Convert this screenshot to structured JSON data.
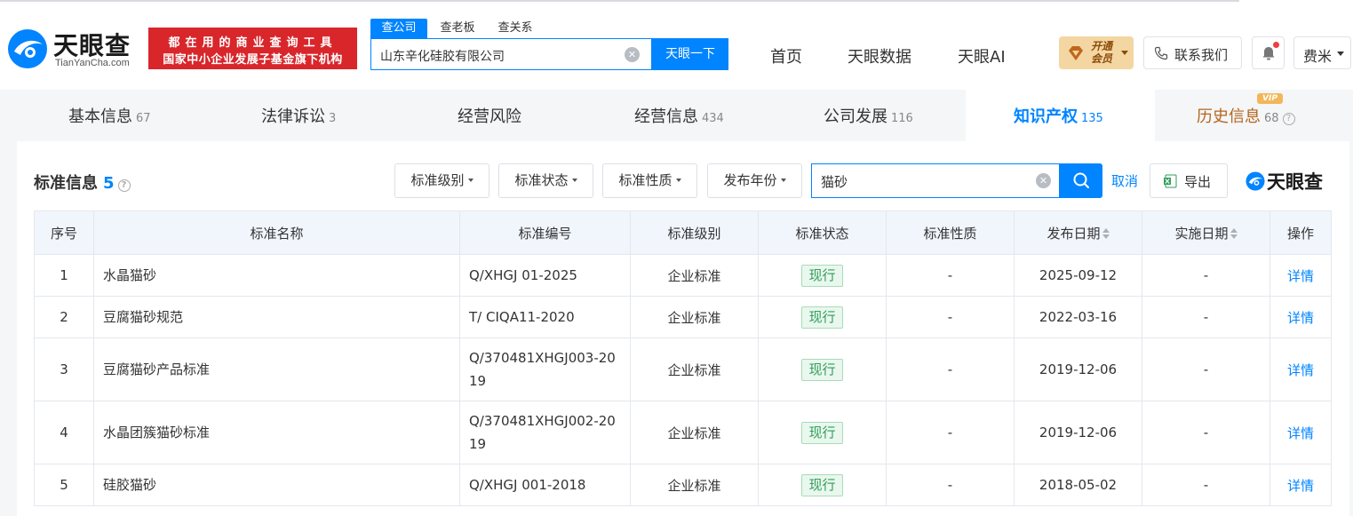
{
  "header": {
    "logo_text": "天眼查",
    "logo_sub": "TianYanCha.com",
    "banner_line1": "都在用的商业查询工具",
    "banner_line2": "国家中小企业发展子基金旗下机构",
    "search_tabs": [
      "查公司",
      "查老板",
      "查关系"
    ],
    "search_value": "山东辛化硅胶有限公司",
    "search_button": "天眼一下",
    "nav": [
      "首页",
      "天眼数据",
      "天眼AI"
    ],
    "vip_label": "开通会员",
    "contact_label": "联系我们",
    "user_name": "费米"
  },
  "tabs": [
    {
      "label": "基本信息",
      "count": "67"
    },
    {
      "label": "法律诉讼",
      "count": "3"
    },
    {
      "label": "经营风险",
      "count": ""
    },
    {
      "label": "经营信息",
      "count": "434"
    },
    {
      "label": "公司发展",
      "count": "116"
    },
    {
      "label": "知识产权",
      "count": "135"
    },
    {
      "label": "历史信息",
      "count": "68"
    }
  ],
  "vip_tag": "VIP",
  "section": {
    "title": "标准信息",
    "count": "5",
    "filters": [
      "标准级别",
      "标准状态",
      "标准性质",
      "发布年份"
    ],
    "search_value": "猫砂",
    "cancel_label": "取消",
    "export_label": "导出",
    "brand": "天眼查"
  },
  "table": {
    "columns": [
      "序号",
      "标准名称",
      "标准编号",
      "标准级别",
      "标准状态",
      "标准性质",
      "发布日期",
      "实施日期",
      "操作"
    ],
    "rows": [
      {
        "no": "1",
        "name": "水晶猫砂",
        "code": "Q/XHGJ 01-2025",
        "level": "企业标准",
        "status": "现行",
        "nature": "-",
        "publish": "2025-09-12",
        "implement": "-",
        "action": "详情"
      },
      {
        "no": "2",
        "name": "豆腐猫砂规范",
        "code": "T/ CIQA11-2020",
        "level": "企业标准",
        "status": "现行",
        "nature": "-",
        "publish": "2022-03-16",
        "implement": "-",
        "action": "详情"
      },
      {
        "no": "3",
        "name": "豆腐猫砂产品标准",
        "code": "Q/370481XHGJ003-2019",
        "level": "企业标准",
        "status": "现行",
        "nature": "-",
        "publish": "2019-12-06",
        "implement": "-",
        "action": "详情"
      },
      {
        "no": "4",
        "name": "水晶团簇猫砂标准",
        "code": "Q/370481XHGJ002-2019",
        "level": "企业标准",
        "status": "现行",
        "nature": "-",
        "publish": "2019-12-06",
        "implement": "-",
        "action": "详情"
      },
      {
        "no": "5",
        "name": "硅胶猫砂",
        "code": "Q/XHGJ 001-2018",
        "level": "企业标准",
        "status": "现行",
        "nature": "-",
        "publish": "2018-05-02",
        "implement": "-",
        "action": "详情"
      }
    ]
  },
  "colors": {
    "brand_blue": "#0084ff",
    "banner_red": "#d8262b",
    "status_green": "#2e9e58",
    "vip_gold": "#f4d6a2"
  }
}
